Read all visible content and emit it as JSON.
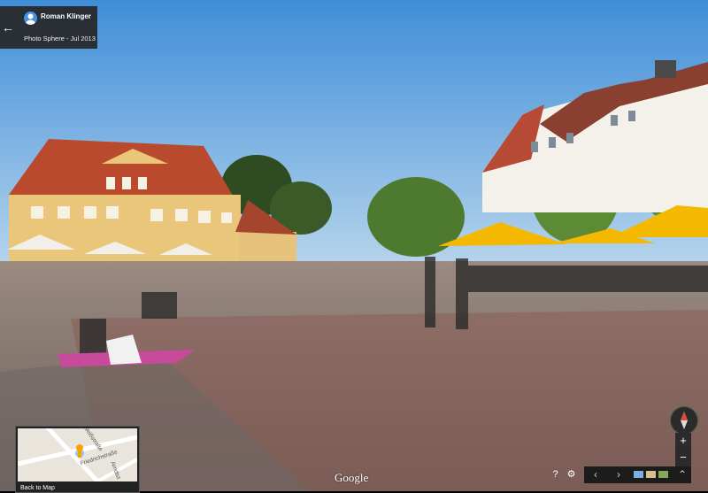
{
  "info_card": {
    "author": "Roman Klinger",
    "subtitle": "Photo Sphere - Jul 2013"
  },
  "minimap": {
    "streets": [
      "Weißstraße",
      "Friedrichstraße",
      "Arndtst"
    ],
    "back_label": "Back to Map"
  },
  "branding": "Google",
  "colors": {
    "sky_top": "#3f8ed8",
    "sky_bottom": "#b6d4ec",
    "pavement": "#8c7b72",
    "umbrella": "#f5b800",
    "building": "#e9c67a",
    "roof": "#b94a2e"
  },
  "icons": [
    "back-arrow-icon",
    "avatar-icon",
    "compass-icon",
    "help-icon",
    "settings-icon",
    "chevron-left-icon",
    "chevron-right-icon",
    "expand-icon"
  ]
}
